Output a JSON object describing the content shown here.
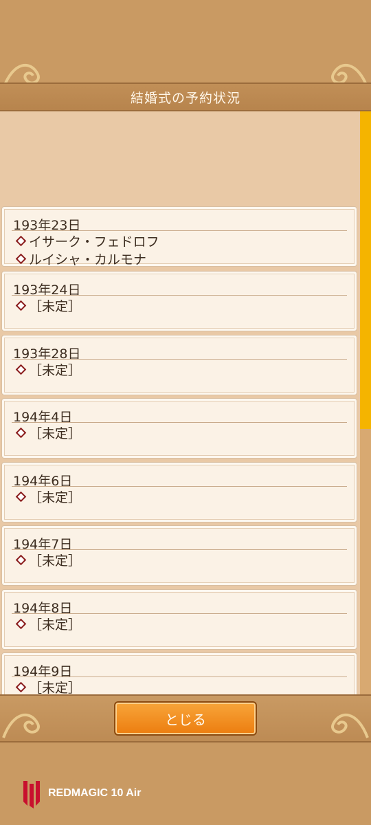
{
  "header": {
    "title": "結婚式の予約状況"
  },
  "entries": [
    {
      "date": "193年23日",
      "lines": [
        "イサーク・フェドロフ",
        "ルイシャ・カルモナ"
      ]
    },
    {
      "date": "193年24日",
      "lines": [
        "［未定］"
      ]
    },
    {
      "date": "193年28日",
      "lines": [
        "［未定］"
      ]
    },
    {
      "date": "194年4日",
      "lines": [
        "［未定］"
      ]
    },
    {
      "date": "194年6日",
      "lines": [
        "［未定］"
      ]
    },
    {
      "date": "194年7日",
      "lines": [
        "［未定］"
      ]
    },
    {
      "date": "194年8日",
      "lines": [
        "［未定］"
      ]
    },
    {
      "date": "194年9日",
      "lines": [
        "［未定］"
      ]
    }
  ],
  "footer": {
    "close_label": "とじる"
  },
  "watermark": {
    "brand": "REDMAGIC 10 Air"
  },
  "colors": {
    "accent": "#f5b400",
    "button": "#ec7d0f",
    "marker": "#8a1b1b"
  }
}
